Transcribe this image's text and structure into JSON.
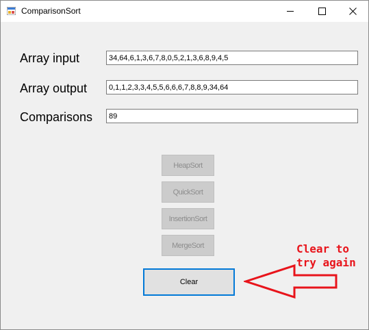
{
  "window": {
    "title": "ComparisonSort"
  },
  "fields": {
    "array_input_label": "Array input",
    "array_input_value": "34,64,6,1,3,6,7,8,0,5,2,1,3,6,8,9,4,5",
    "array_output_label": "Array output",
    "array_output_value": "0,1,1,2,3,3,4,5,5,6,6,6,7,8,8,9,34,64",
    "comparisons_label": "Comparisons",
    "comparisons_value": "89"
  },
  "buttons": {
    "heapsort": "HeapSort",
    "quicksort": "QuickSort",
    "insertionsort": "InsertionSort",
    "mergesort": "MergeSort",
    "clear": "Clear"
  },
  "annotation": {
    "line1": "Clear to",
    "line2": "try again",
    "color": "#e8141b"
  },
  "colors": {
    "accent": "#0078d7"
  }
}
